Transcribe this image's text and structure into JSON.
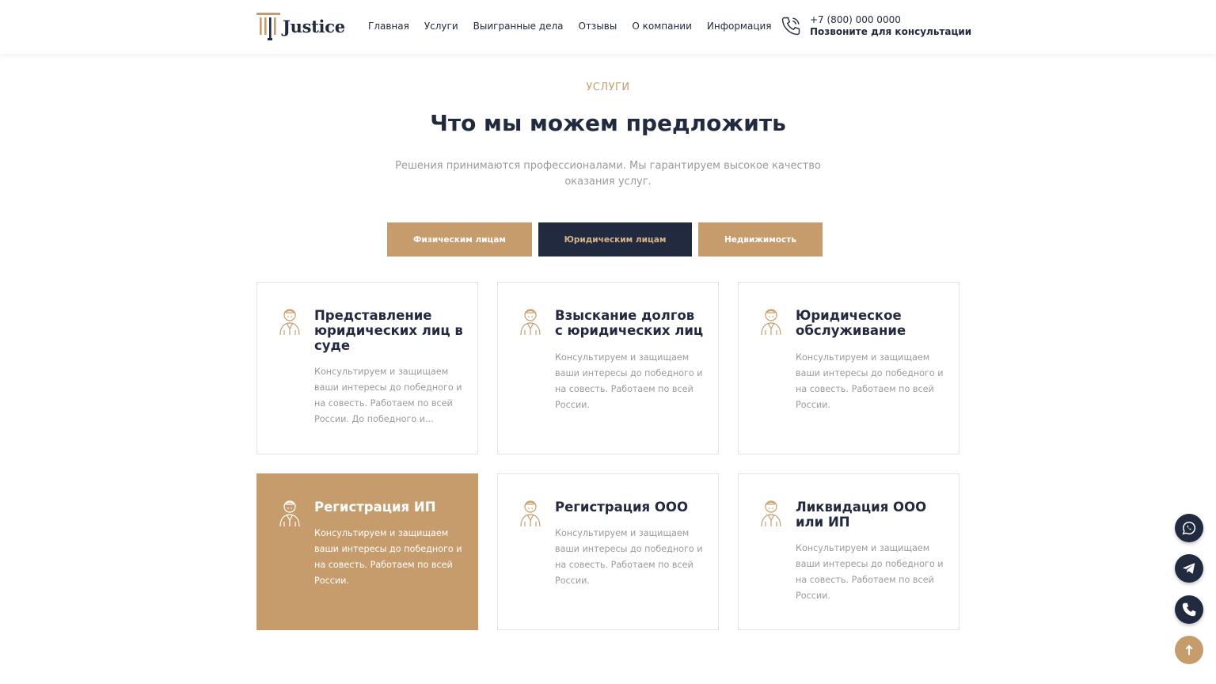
{
  "header": {
    "logo_text": "Justice",
    "nav": [
      "Главная",
      "Услуги",
      "Выигранные дела",
      "Отзывы",
      "О компании",
      "Информация"
    ],
    "phone": "+7 (800) 000 0000",
    "phone_note": "Позвоните для консультации"
  },
  "section": {
    "subtitle": "УСЛУГИ",
    "title": "Что мы можем предложить",
    "description": "Решения принимаются профессионалами. Мы гарантируем высокое качество оказания услуг."
  },
  "tabs": [
    {
      "label": "Физическим лицам",
      "active": false
    },
    {
      "label": "Юридическим лицам",
      "active": true
    },
    {
      "label": "Недвижимость",
      "active": false
    }
  ],
  "cards": [
    {
      "title": "Представление юридических лиц в суде",
      "text": "Консультируем и защищаем ваши интересы до победного и на совесть. Работаем по всей России. До победного и...",
      "icon": "lawyer-icon"
    },
    {
      "title": "Взыскание долгов с юридических лиц",
      "text": "Консультируем и защищаем ваши интересы до победного и на совесть. Работаем по всей России.",
      "icon": "lawyer-icon"
    },
    {
      "title": "Юридическое обслуживание",
      "text": "Консультируем и защищаем ваши интересы до победного и на совесть. Работаем по всей России.",
      "icon": "lawyer-icon"
    },
    {
      "title": "Регистрация ИП",
      "text": "Консультируем и защищаем ваши интересы до победного и на совесть. Работаем по всей России.",
      "icon": "lawyer-icon",
      "highlighted": true
    },
    {
      "title": "Регистрация ООО",
      "text": "Консультируем и защищаем ваши интересы до победного и на совесть. Работаем по всей России.",
      "icon": "lawyer-icon"
    },
    {
      "title": "Ликвидация ООО или ИП",
      "text": "Консультируем и защищаем ваши интересы до победного и на совесть. Работаем по всей России.",
      "icon": "lawyer-icon"
    }
  ],
  "floating_buttons": [
    "whatsapp-icon",
    "telegram-icon",
    "phone-icon",
    "arrow-up-icon"
  ],
  "colors": {
    "accent": "#c69c6d",
    "dark": "#222a3f",
    "muted_text": "#9a9a9a"
  }
}
